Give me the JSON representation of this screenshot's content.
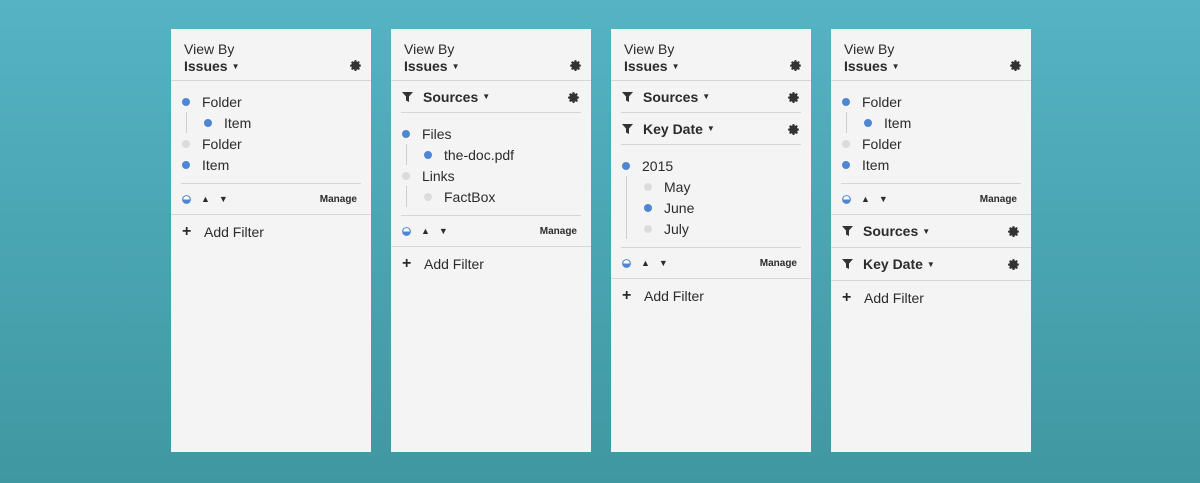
{
  "view_by_label": "View By",
  "view_by_value": "Issues",
  "manage_label": "Manage",
  "add_filter_label": "Add Filter",
  "sources_label": "Sources",
  "key_date_label": "Key Date",
  "colors": {
    "selected_dot": "#4f86d4",
    "unselected_dot": "#dcdcdc",
    "background_top": "#55b3c4",
    "background_bottom": "#3f97a1",
    "panel": "#f4f4f4"
  },
  "icons": {
    "settings": "gear-icon",
    "filter": "funnel-icon",
    "dropdown": "caret-down-icon",
    "toggle": "half-circle-icon",
    "sort_up": "arrow-up-icon",
    "sort_down": "arrow-down-icon",
    "add": "plus-icon"
  },
  "panels": [
    {
      "tree": [
        {
          "label": "Folder",
          "selected": true
        },
        {
          "label": "Item",
          "selected": true
        },
        {
          "label": "Folder",
          "selected": false
        },
        {
          "label": "Item",
          "selected": true
        }
      ]
    },
    {
      "tree": [
        {
          "label": "Files",
          "selected": true
        },
        {
          "label": "the-doc.pdf",
          "selected": true
        },
        {
          "label": "Links",
          "selected": false
        },
        {
          "label": "FactBox",
          "selected": false
        }
      ]
    },
    {
      "tree": [
        {
          "label": "2015",
          "selected": true
        },
        {
          "label": "May",
          "selected": false
        },
        {
          "label": "June",
          "selected": true
        },
        {
          "label": "July",
          "selected": false
        }
      ]
    },
    {
      "tree": [
        {
          "label": "Folder",
          "selected": true
        },
        {
          "label": "Item",
          "selected": true
        },
        {
          "label": "Folder",
          "selected": false
        },
        {
          "label": "Item",
          "selected": true
        }
      ]
    }
  ]
}
